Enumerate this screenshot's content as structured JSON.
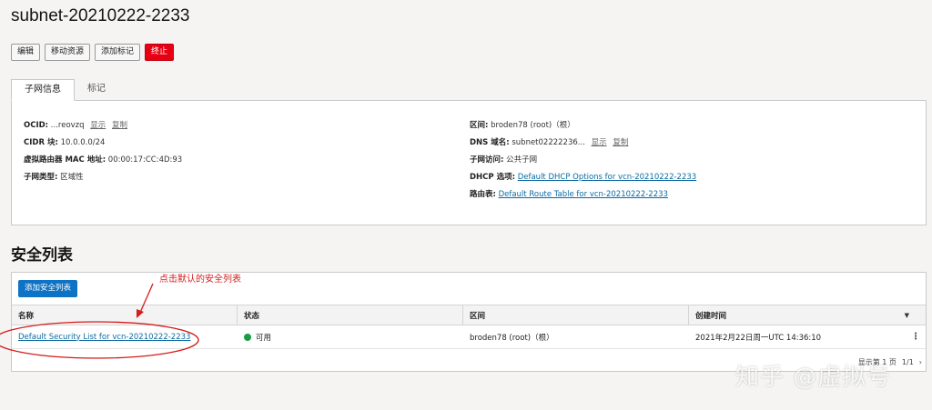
{
  "page_title": "subnet-20210222-2233",
  "actions": {
    "edit": "编辑",
    "move": "移动资源",
    "add_tag": "添加标记",
    "terminate": "终止"
  },
  "tabs": {
    "subnet_info": "子网信息",
    "tags": "标记"
  },
  "info_left": {
    "ocid_label": "OCID:",
    "ocid_value": "...reovzq",
    "show": "显示",
    "copy": "复制",
    "cidr_label": "CIDR 块:",
    "cidr_value": "10.0.0.0/24",
    "mac_label": "虚拟路由器 MAC 地址:",
    "mac_value": "00:00:17:CC:4D:93",
    "type_label": "子网类型:",
    "type_value": "区域性"
  },
  "info_right": {
    "compartment_label": "区间:",
    "compartment_value": "broden78 (root)（根）",
    "dns_label": "DNS 域名:",
    "dns_value": "subnet02222236...",
    "show": "显示",
    "copy": "复制",
    "access_label": "子网访问:",
    "access_value": "公共子网",
    "dhcp_label": "DHCP 选项:",
    "dhcp_value": "Default DHCP Options for vcn-20210222-2233",
    "route_label": "路由表:",
    "route_value": "Default Route Table for vcn-20210222-2233"
  },
  "security_lists": {
    "section_title": "安全列表",
    "add_button": "添加安全列表",
    "columns": [
      "名称",
      "状态",
      "区间",
      "创建时间"
    ],
    "rows": [
      {
        "name": "Default Security List for vcn-20210222-2233",
        "status": "可用",
        "compartment": "broden78 (root)（根）",
        "created": "2021年2月22日周一UTC 14:36:10"
      }
    ],
    "pager": "显示第 1 页",
    "pager_count": "1/1"
  },
  "annotation": {
    "text": "点击默认的安全列表",
    "color": "#d41c1c"
  },
  "watermark": "知乎 @虚拟号",
  "colors": {
    "primary": "#0e72c5",
    "danger": "#e60012",
    "available": "#1a9b43",
    "link": "#0b6aa2"
  }
}
